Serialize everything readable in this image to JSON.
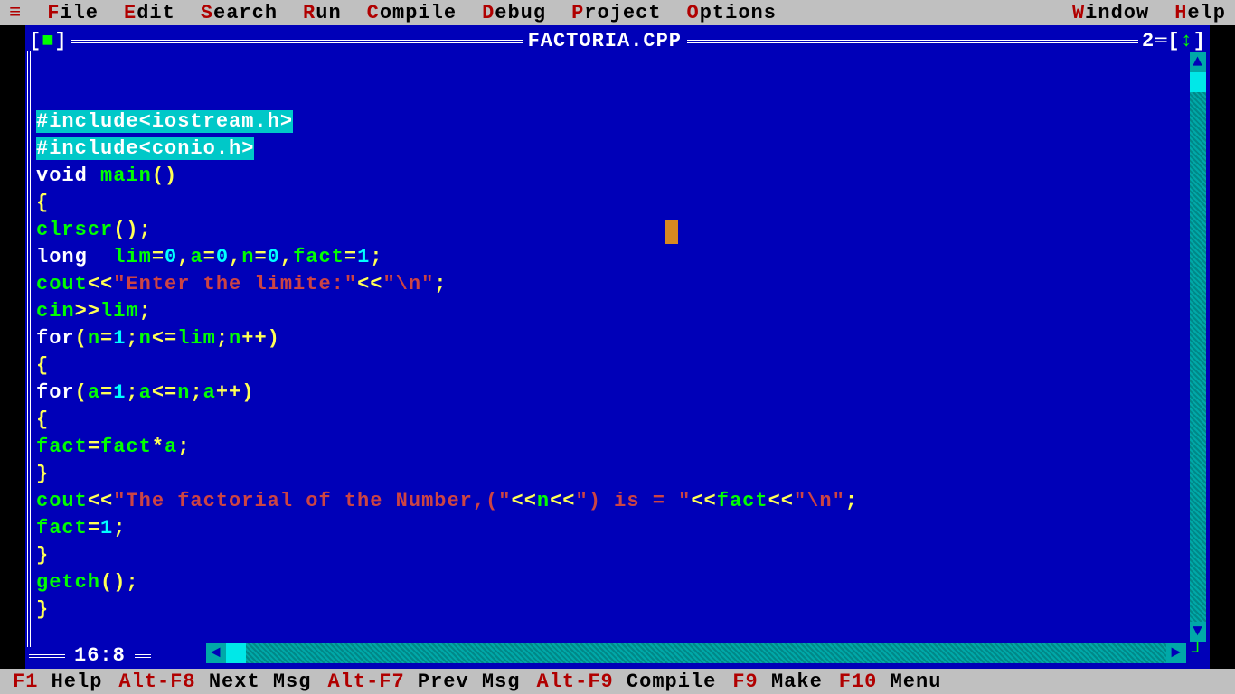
{
  "menu": {
    "sys": "≡",
    "items": [
      {
        "hk": "F",
        "rest": "ile"
      },
      {
        "hk": "E",
        "rest": "dit"
      },
      {
        "hk": "S",
        "rest": "earch"
      },
      {
        "hk": "R",
        "rest": "un"
      },
      {
        "hk": "C",
        "rest": "ompile"
      },
      {
        "hk": "D",
        "rest": "ebug"
      },
      {
        "hk": "P",
        "rest": "roject"
      },
      {
        "hk": "O",
        "rest": "ptions"
      }
    ],
    "right": [
      {
        "hk": "W",
        "rest": "indow"
      },
      {
        "hk": "H",
        "rest": "elp"
      }
    ]
  },
  "window": {
    "close_l": "[",
    "close_sym": "■",
    "close_r": "]",
    "title": " FACTORIA.CPP ",
    "num_prefix": "2═[",
    "num_sym": "↕",
    "num_suffix": "]"
  },
  "code": {
    "lines": [
      [
        {
          "c": "sel",
          "t": "#include<iostream.h>"
        }
      ],
      [
        {
          "c": "sel",
          "t": "#include<conio.h>"
        }
      ],
      [
        {
          "c": "kw-white",
          "t": "void "
        },
        {
          "c": "kw-green",
          "t": "main"
        },
        {
          "c": "kw-yellow",
          "t": "()"
        }
      ],
      [
        {
          "c": "kw-yellow",
          "t": "{"
        }
      ],
      [
        {
          "c": "kw-green",
          "t": "clrscr"
        },
        {
          "c": "kw-yellow",
          "t": "();"
        }
      ],
      [
        {
          "c": "kw-white",
          "t": "long  "
        },
        {
          "c": "kw-green",
          "t": "lim"
        },
        {
          "c": "kw-yellow",
          "t": "="
        },
        {
          "c": "kw-cyan",
          "t": "0"
        },
        {
          "c": "kw-yellow",
          "t": ","
        },
        {
          "c": "kw-green",
          "t": "a"
        },
        {
          "c": "kw-yellow",
          "t": "="
        },
        {
          "c": "kw-cyan",
          "t": "0"
        },
        {
          "c": "kw-yellow",
          "t": ","
        },
        {
          "c": "kw-green",
          "t": "n"
        },
        {
          "c": "kw-yellow",
          "t": "="
        },
        {
          "c": "kw-cyan",
          "t": "0"
        },
        {
          "c": "kw-yellow",
          "t": ","
        },
        {
          "c": "kw-green",
          "t": "fact"
        },
        {
          "c": "kw-yellow",
          "t": "="
        },
        {
          "c": "kw-cyan",
          "t": "1"
        },
        {
          "c": "kw-yellow",
          "t": ";"
        }
      ],
      [
        {
          "c": "kw-green",
          "t": "cout"
        },
        {
          "c": "kw-yellow",
          "t": "<<"
        },
        {
          "c": "kw-red",
          "t": "\"Enter the limite:\""
        },
        {
          "c": "kw-yellow",
          "t": "<<"
        },
        {
          "c": "kw-red",
          "t": "\"\\n\""
        },
        {
          "c": "kw-yellow",
          "t": ";"
        }
      ],
      [
        {
          "c": "kw-green",
          "t": "cin"
        },
        {
          "c": "kw-yellow",
          "t": ">>"
        },
        {
          "c": "kw-green",
          "t": "lim"
        },
        {
          "c": "kw-yellow",
          "t": ";"
        }
      ],
      [
        {
          "c": "kw-white",
          "t": "for"
        },
        {
          "c": "kw-yellow",
          "t": "("
        },
        {
          "c": "kw-green",
          "t": "n"
        },
        {
          "c": "kw-yellow",
          "t": "="
        },
        {
          "c": "kw-cyan",
          "t": "1"
        },
        {
          "c": "kw-yellow",
          "t": ";"
        },
        {
          "c": "kw-green",
          "t": "n"
        },
        {
          "c": "kw-yellow",
          "t": "<="
        },
        {
          "c": "kw-green",
          "t": "lim"
        },
        {
          "c": "kw-yellow",
          "t": ";"
        },
        {
          "c": "kw-green",
          "t": "n"
        },
        {
          "c": "kw-yellow",
          "t": "++)"
        }
      ],
      [
        {
          "c": "kw-yellow",
          "t": "{"
        }
      ],
      [
        {
          "c": "kw-white",
          "t": "for"
        },
        {
          "c": "kw-yellow",
          "t": "("
        },
        {
          "c": "kw-green",
          "t": "a"
        },
        {
          "c": "kw-yellow",
          "t": "="
        },
        {
          "c": "kw-cyan",
          "t": "1"
        },
        {
          "c": "kw-yellow",
          "t": ";"
        },
        {
          "c": "kw-green",
          "t": "a"
        },
        {
          "c": "kw-yellow",
          "t": "<="
        },
        {
          "c": "kw-green",
          "t": "n"
        },
        {
          "c": "kw-yellow",
          "t": ";"
        },
        {
          "c": "kw-green",
          "t": "a"
        },
        {
          "c": "kw-yellow",
          "t": "++)"
        }
      ],
      [
        {
          "c": "kw-yellow",
          "t": "{"
        }
      ],
      [
        {
          "c": "kw-green",
          "t": "fact"
        },
        {
          "c": "kw-yellow",
          "t": "="
        },
        {
          "c": "kw-green",
          "t": "fact"
        },
        {
          "c": "kw-yellow",
          "t": "*"
        },
        {
          "c": "kw-green",
          "t": "a"
        },
        {
          "c": "kw-yellow",
          "t": ";"
        }
      ],
      [
        {
          "c": "kw-yellow",
          "t": "}"
        }
      ],
      [
        {
          "c": "kw-green",
          "t": "cout"
        },
        {
          "c": "kw-yellow",
          "t": "<<"
        },
        {
          "c": "kw-red",
          "t": "\"The factorial of the Number,(\""
        },
        {
          "c": "kw-yellow",
          "t": "<<"
        },
        {
          "c": "kw-green",
          "t": "n"
        },
        {
          "c": "kw-yellow",
          "t": "<<"
        },
        {
          "c": "kw-red",
          "t": "\") is = \""
        },
        {
          "c": "kw-yellow",
          "t": "<<"
        },
        {
          "c": "kw-green",
          "t": "fact"
        },
        {
          "c": "kw-yellow",
          "t": "<<"
        },
        {
          "c": "kw-red",
          "t": "\"\\n\""
        },
        {
          "c": "kw-yellow",
          "t": ";"
        }
      ],
      [
        {
          "c": "kw-green",
          "t": "fact"
        },
        {
          "c": "kw-yellow",
          "t": "="
        },
        {
          "c": "kw-cyan",
          "t": "1"
        },
        {
          "c": "kw-yellow",
          "t": ";"
        }
      ],
      [
        {
          "c": "kw-yellow",
          "t": "}"
        }
      ],
      [
        {
          "c": "kw-green",
          "t": "getch"
        },
        {
          "c": "kw-yellow",
          "t": "();"
        }
      ],
      [
        {
          "c": "kw-yellow",
          "t": "}"
        }
      ]
    ]
  },
  "position": "16:8",
  "status": [
    {
      "fk": "F1",
      "label": " Help"
    },
    {
      "fk": "Alt-F8",
      "label": " Next Msg"
    },
    {
      "fk": "Alt-F7",
      "label": " Prev Msg"
    },
    {
      "fk": "Alt-F9",
      "label": " Compile"
    },
    {
      "fk": "F9",
      "label": " Make"
    },
    {
      "fk": "F10",
      "label": " Menu"
    }
  ]
}
